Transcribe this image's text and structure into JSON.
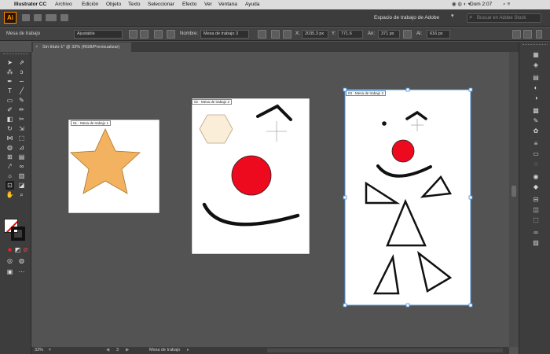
{
  "menubar": {
    "apple": "",
    "app": "Illustrator CC",
    "menus": [
      "Archivo",
      "Edición",
      "Objeto",
      "Texto",
      "Seleccionar",
      "Efecto",
      "Ver",
      "Ventana",
      "Ayuda"
    ],
    "clock": "Dom 2:07"
  },
  "appbar": {
    "logo": "Ai",
    "workspace": "Espacio de trabajo de Adobe",
    "search_placeholder": "Buscar en Adobe Stock"
  },
  "controlbar": {
    "mode_label": "Mesa de trabajo",
    "preset_value": "Ajustable",
    "name_label": "Nombre:",
    "name_value": "Mesa de trabajo 3",
    "x_label": "X:",
    "x_value": "2035.3 px",
    "y_label": "Y:",
    "y_value": "771.6",
    "w_label": "An:",
    "w_value": "371 px",
    "h_label": "Al:",
    "h_value": "616 px"
  },
  "document": {
    "tab_label": "Sin título-1* @ 33% (RGB/Previsualizar)",
    "close_glyph": "×"
  },
  "artboards": [
    {
      "label": "01 - Mesa de trabajo 1"
    },
    {
      "label": "02 - Mesa de trabajo 2"
    },
    {
      "label": "03 - Mesa de trabajo 3"
    }
  ],
  "status": {
    "zoom": "33%",
    "artboard_index": "3",
    "tool": "Mesa de trabajo"
  },
  "colors": {
    "star_fill": "#f2b25f",
    "nose_red": "#ee0a1e",
    "hexagon_fill": "#fbeed8",
    "selection_blue": "#4a90d9",
    "canvas_gray": "#535353"
  },
  "icons": {
    "tools": [
      "selection",
      "direct-selection",
      "magic-wand",
      "lasso",
      "pen",
      "curvature",
      "type",
      "line",
      "rectangle",
      "paintbrush",
      "shaper",
      "pencil",
      "eraser",
      "scissors",
      "rotate",
      "scale",
      "width",
      "free-transform",
      "shape-builder",
      "perspective",
      "mesh",
      "gradient",
      "eyedropper",
      "blend",
      "symbol-sprayer",
      "column-graph",
      "artboard",
      "slice",
      "hand",
      "zoom"
    ],
    "panels": [
      "properties",
      "layers",
      "libraries",
      "color",
      "color-guide",
      "swatches",
      "brushes",
      "symbols",
      "stroke",
      "gradient",
      "transparency",
      "appearance",
      "graphic-styles",
      "align",
      "pathfinder",
      "transform",
      "links",
      "image-trace"
    ]
  }
}
